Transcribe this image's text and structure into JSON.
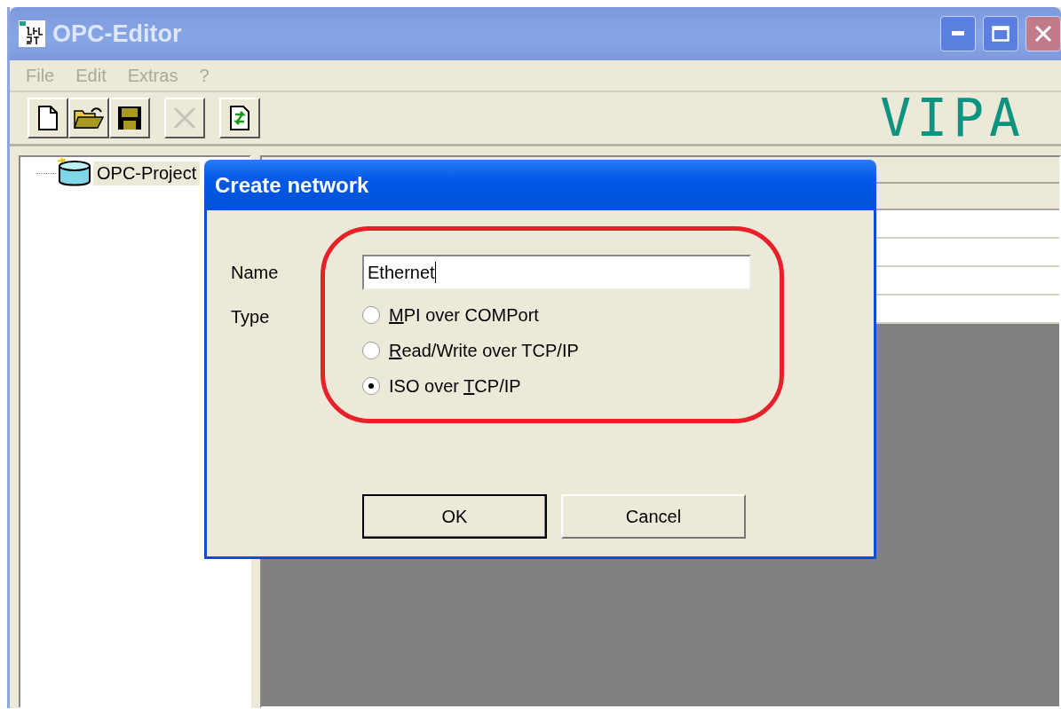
{
  "window": {
    "title": "OPC-Editor"
  },
  "menu": [
    {
      "label": "File"
    },
    {
      "label": "Edit"
    },
    {
      "label": "Extras"
    },
    {
      "label": "?"
    }
  ],
  "toolbar": [
    {
      "kind": "new",
      "disabled": false
    },
    {
      "kind": "open",
      "disabled": false
    },
    {
      "kind": "save",
      "disabled": false
    },
    {
      "kind": "delete",
      "disabled": true
    },
    {
      "kind": "convert",
      "disabled": false
    }
  ],
  "logo": "VIPA",
  "tree": [
    {
      "label": "OPC-Project",
      "selected": true
    }
  ],
  "dialog": {
    "title": "Create network",
    "name_label": "Name",
    "name_value": "Ethernet",
    "type_label": "Type",
    "options": [
      {
        "label": [
          {
            "text": "M",
            "underlined": true
          },
          {
            "text": "PI over COMPort",
            "underlined": false
          }
        ],
        "selected": false
      },
      {
        "label": [
          {
            "text": "R",
            "underlined": true
          },
          {
            "text": "ead/Write over TCP/IP",
            "underlined": false
          }
        ],
        "selected": false
      },
      {
        "label": [
          {
            "text": "ISO over ",
            "underlined": false
          },
          {
            "text": "T",
            "underlined": true
          },
          {
            "text": "CP/IP",
            "underlined": false
          }
        ],
        "selected": true
      }
    ],
    "buttons": [
      {
        "label": "OK",
        "default": true
      },
      {
        "label": "Cancel",
        "default": false
      }
    ]
  }
}
